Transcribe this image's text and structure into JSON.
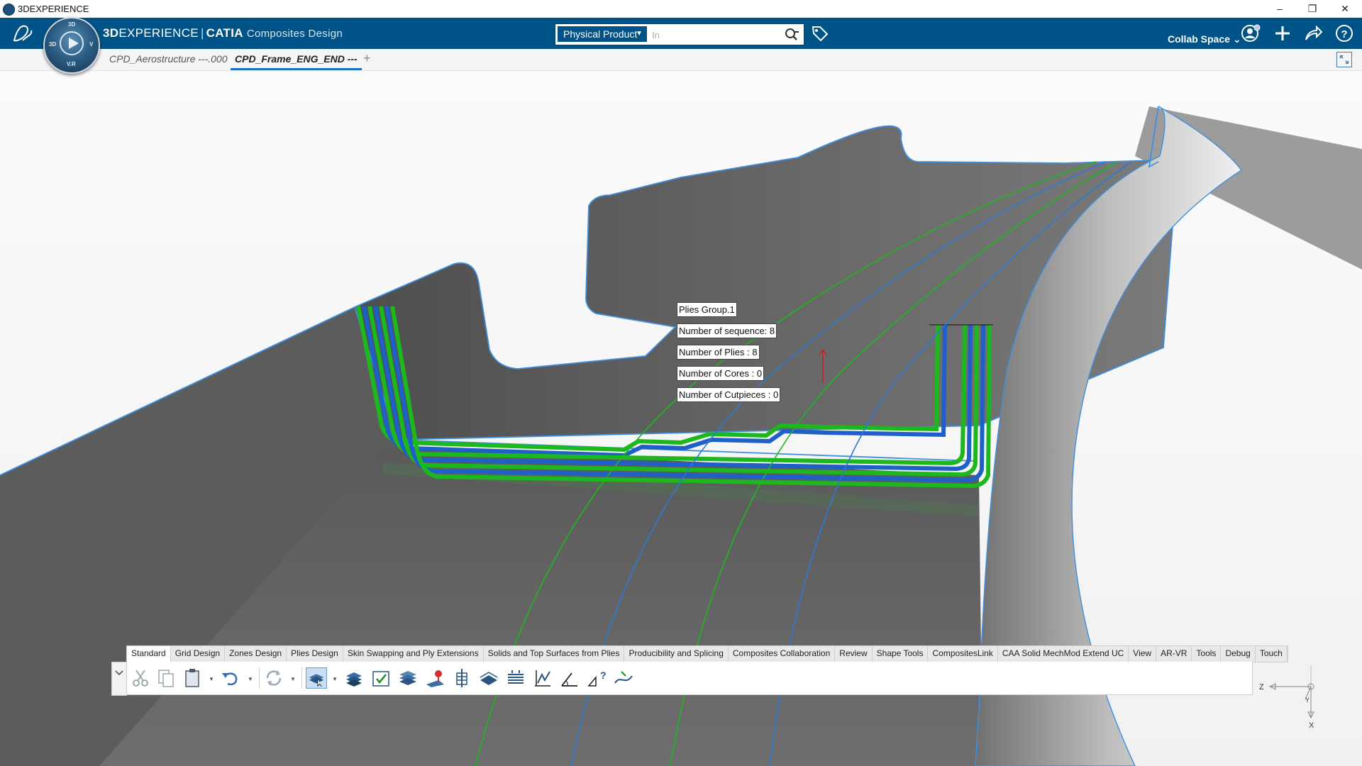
{
  "window": {
    "title": "3DEXPERIENCE",
    "minimize": "–",
    "restore": "❐",
    "close": "✕"
  },
  "header": {
    "brand_bold": "3D",
    "brand_rest": "EXPERIENCE",
    "brand_sep": "|",
    "brand_app": "CATIA",
    "brand_sub": "Composites Design",
    "search_scope": "Physical Product",
    "search_placeholder": "In",
    "collab_space": "Collab Space",
    "colors": {
      "bar": "#005386",
      "accent": "#1a73c2"
    }
  },
  "compass": {
    "top": "3D",
    "left": "3D",
    "right": "V",
    "bottom": "V.R"
  },
  "tabs": [
    {
      "label": "CPD_Aerostructure ---.000",
      "active": false
    },
    {
      "label": "CPD_Frame_ENG_END ---",
      "active": true
    }
  ],
  "labels": {
    "plies_group": "Plies Group.1",
    "sequences": "Number of sequence: 8",
    "plies": "Number of Plies : 8",
    "cores": "Number of Cores : 0",
    "cutpieces": "Number of Cutpieces : 0"
  },
  "triad": {
    "z": "Z",
    "y": "Y",
    "x": "X"
  },
  "action_bar": {
    "tabs": [
      "Standard",
      "Grid Design",
      "Zones Design",
      "Plies Design",
      "Skin Swapping and Ply Extensions",
      "Solids and Top Surfaces from Plies",
      "Producibility and Splicing",
      "Composites Collaboration",
      "Review",
      "Shape Tools",
      "CompositesLink",
      "CAA Solid MechMod Extend UC",
      "View",
      "AR-VR",
      "Tools",
      "Debug",
      "Touch"
    ],
    "active_tab": "Standard"
  },
  "scene_colors": {
    "surface": "#5f5f5f",
    "ply_green": "#1db81d",
    "ply_blue": "#1f5fc8"
  }
}
